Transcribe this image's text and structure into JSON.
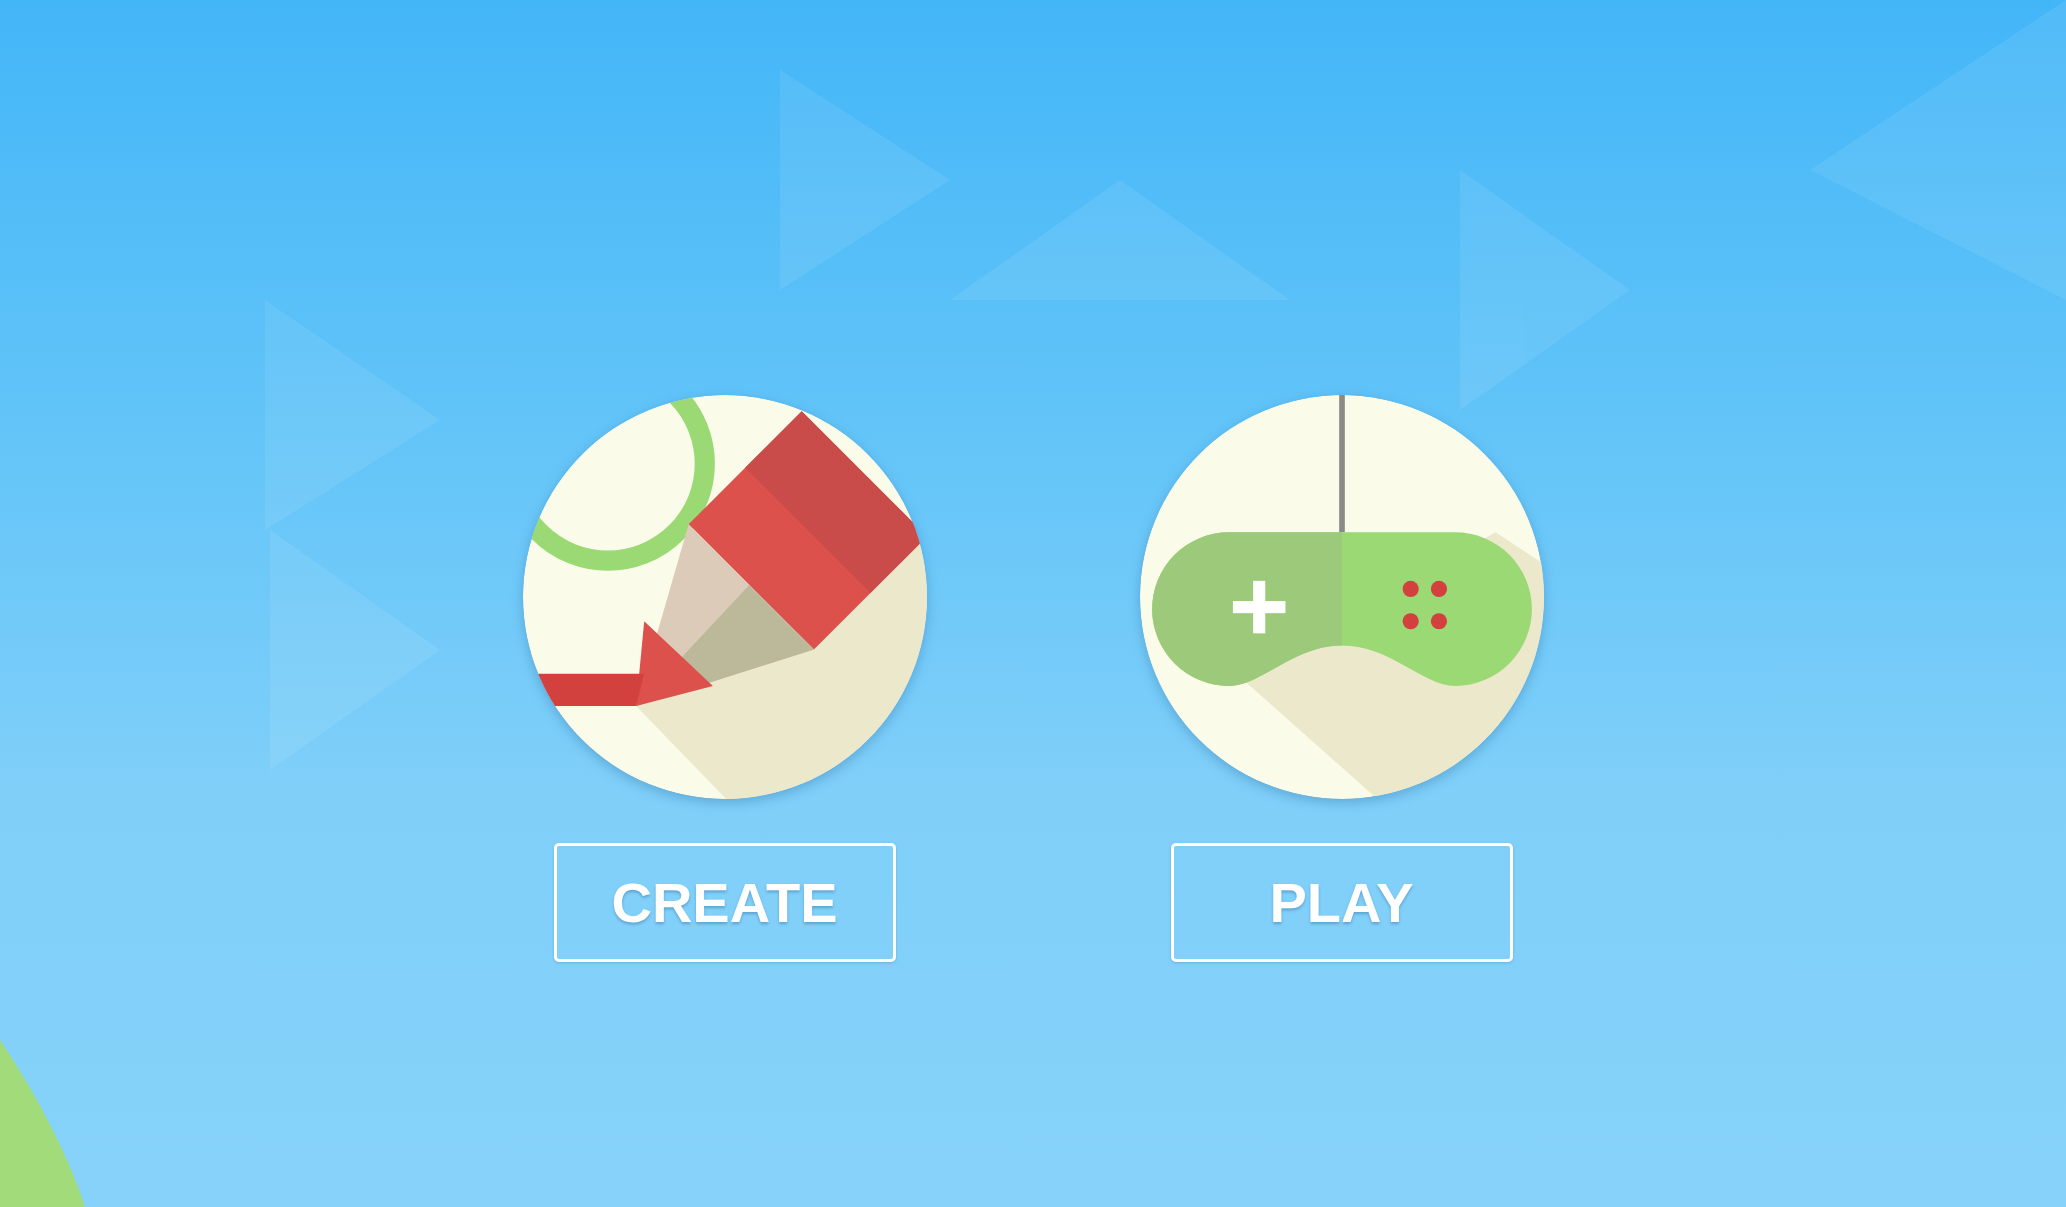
{
  "menu": [
    {
      "kind": "create",
      "label": "CREATE"
    },
    {
      "kind": "play",
      "label": "PLAY"
    }
  ]
}
